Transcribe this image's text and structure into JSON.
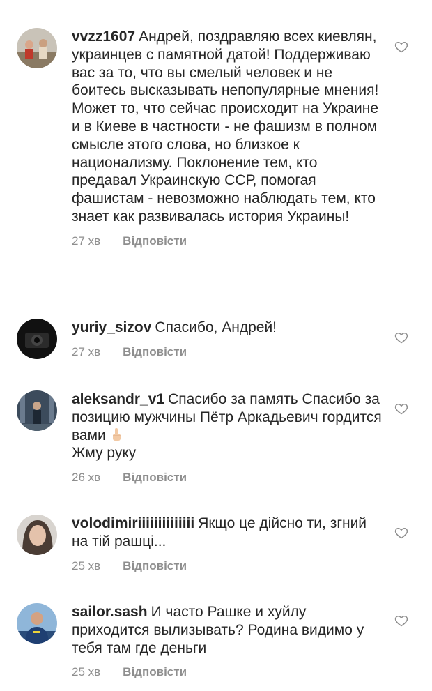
{
  "comments": [
    {
      "username": "vvzz1607",
      "text": "Андрей, поздравляю всех киевлян, украинцев с памятной датой! Поддерживаю вас за то, что вы смелый человек и не боитесь высказывать непопулярные мнения! Может то, что сейчас происходит на Украине и в Киеве в частности - не фашизм в полном смысле этого слова, но близкое к национализму. Поклонение тем, кто предавал Украинскую ССР, помогая фашистам - невозможно наблюдать тем, кто знает как развивалась история Украины!",
      "time": "27 хв",
      "reply_label": "Відповісти"
    },
    {
      "username": "yuriy_sizov",
      "text": "Спасибо, Андрей!",
      "time": "27 хв",
      "reply_label": "Відповісти"
    },
    {
      "username": "aleksandr_v1",
      "text": "Спасибо за память Спасибо за позицию мужчины Пётр Аркадьевич гордится вами",
      "emoji_icon": "index-pointing-up-emoji",
      "line2": "Жму руку",
      "time": "26 хв",
      "reply_label": "Відповісти"
    },
    {
      "username": "volodimiriiiiiiiiiiiiii",
      "text": "Якщо це дійсно ти, згний на тій рашці...",
      "time": "25 хв",
      "reply_label": "Відповісти"
    },
    {
      "username": "sailor.sash",
      "text": "И часто Рашке и хуйлу приходится вылизывать? Родина видимо у тебя там где деньги",
      "time": "25 хв",
      "reply_label": "Відповісти"
    }
  ],
  "colors": {
    "text": "#262626",
    "meta": "#8e8e8e",
    "background": "#ffffff"
  },
  "icons": [
    "heart-outline-icon"
  ]
}
